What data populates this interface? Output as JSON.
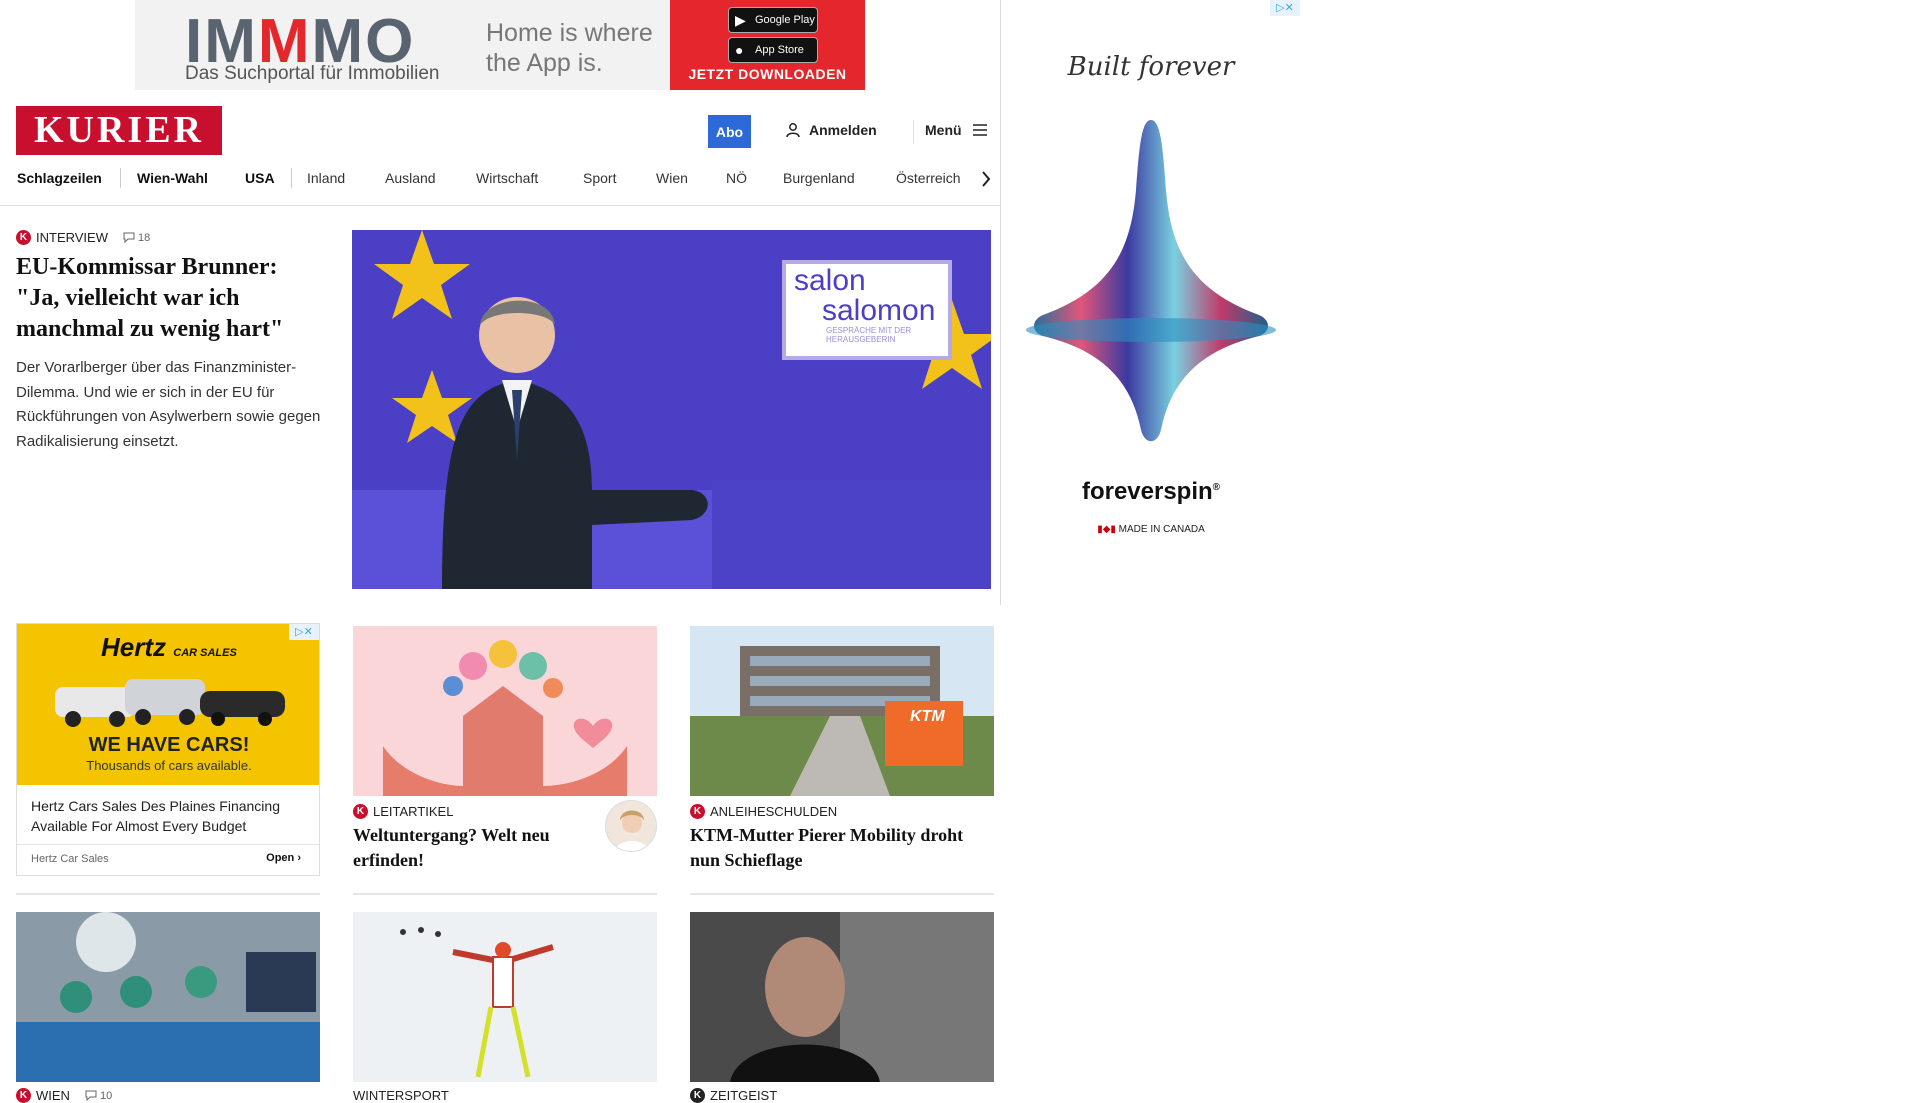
{
  "top_ad": {
    "brand_part1": "IM",
    "brand_part2": "M",
    "brand_part3": "MO",
    "subtitle": "Das Suchportal für Immobilien",
    "tagline": "Home is where the App is.",
    "google_play_small": "JETZT BEI",
    "google_play": "Google Play",
    "app_store_small": "Laden im",
    "app_store": "App Store",
    "cta": "JETZT DOWNLOADEN"
  },
  "side_ad": {
    "script": "Built forever",
    "brand": "foreverspin",
    "registered": "®",
    "made_in": "MADE IN CANADA"
  },
  "header": {
    "logo": "KURIER",
    "abo": "Abo",
    "login": "Anmelden",
    "menu": "Menü"
  },
  "nav": {
    "items": [
      "Schlagzeilen",
      "Wien-Wahl",
      "USA",
      "Inland",
      "Ausland",
      "Wirtschaft",
      "Sport",
      "Wien",
      "NÖ",
      "Burgenland",
      "Österreich"
    ]
  },
  "lead": {
    "kicker": "INTERVIEW",
    "comments": "18",
    "title": "EU-Kommissar Brunner: \"Ja, vielleicht war ich manchmal zu wenig hart\"",
    "teaser": "Der Vorarlberger über das Finanzminister-Dilemma. Und wie er sich in der EU für Rückführungen von Asylwerbern sowie gegen Radikalisierung einsetzt.",
    "badge_line1": "salon",
    "badge_line2": "salomon",
    "badge_small": "GESPRÄCHE MIT DER HERAUSGEBERIN"
  },
  "hertz_ad": {
    "logo": "Hertz",
    "logo_sub": "CAR SALES",
    "headline": "WE HAVE CARS!",
    "sub": "Thousands of cars available.",
    "title": "Hertz Cars Sales Des Plaines Financing Available For Almost Every Budget",
    "source": "Hertz Car Sales",
    "open": "Open"
  },
  "cards": [
    {
      "kicker": "LEITARTIKEL",
      "title": "Weltuntergang? Welt neu erfinden!"
    },
    {
      "kicker": "ANLEIHESCHULDEN",
      "title": "KTM-Mutter Pierer Mobility droht nun Schieflage",
      "sign_text": "KTM"
    }
  ],
  "bottom": [
    {
      "kicker": "WIEN",
      "comments": "10"
    },
    {
      "kicker": "WINTERSPORT"
    },
    {
      "kicker": "ZEITGEIST"
    }
  ],
  "colors": {
    "brand_red": "#c8102e",
    "abo_blue": "#2d6ad8"
  }
}
